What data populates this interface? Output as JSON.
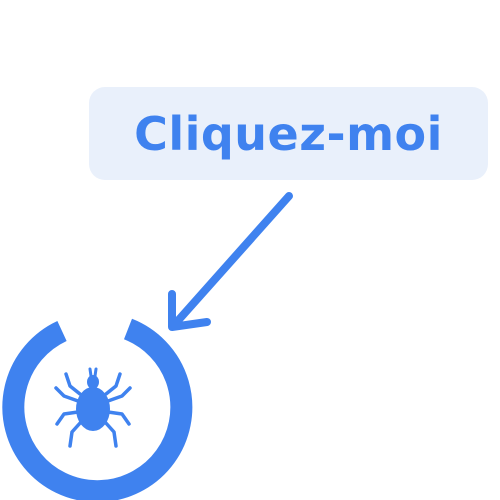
{
  "callout": {
    "label": "Cliquez-moi"
  },
  "colors": {
    "accent": "#3f82ef",
    "callout_background": "#e9f0fb",
    "page_background": "#ffffff"
  },
  "target": {
    "icon": "tick-icon"
  }
}
